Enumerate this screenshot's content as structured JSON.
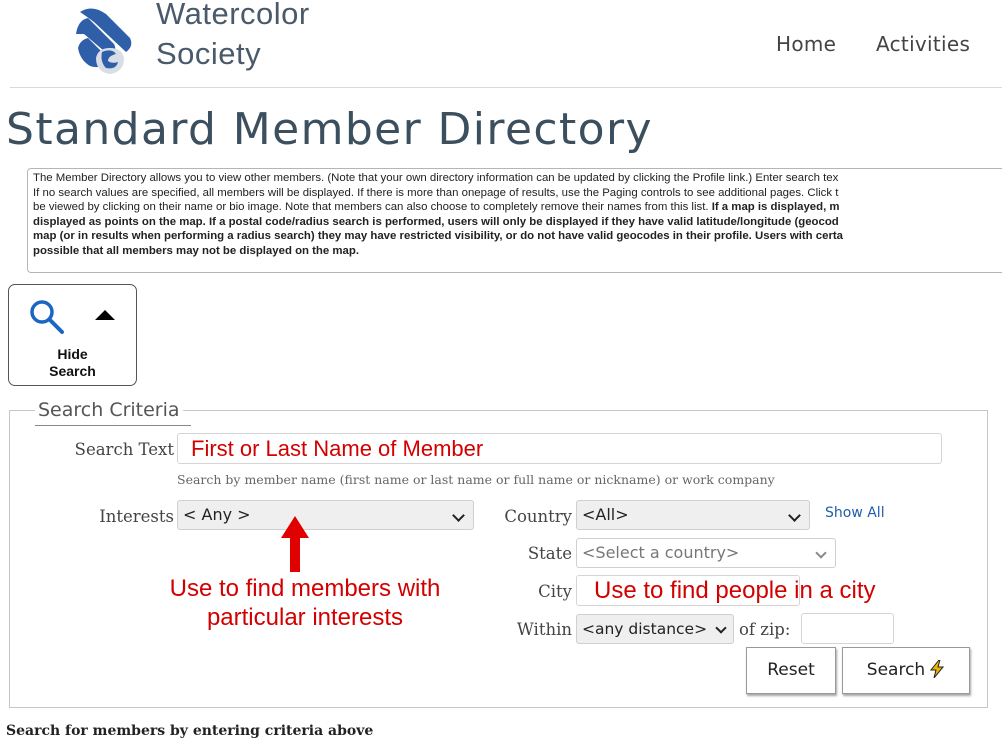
{
  "header": {
    "logo_line1": "Watercolor",
    "logo_line2": "Society",
    "nav": [
      "Home",
      "Activities"
    ]
  },
  "page_title": "Standard Member Directory",
  "info": {
    "lines": [
      "The Member Directory allows you to view other members. (Note that your own directory information can be updated by clicking the Profile link.) Enter search tex",
      "If no search values are specified, all members will be displayed. If there is more than onepage of results, use the Paging controls to see additional pages. Click t",
      "be viewed by clicking on their name or bio image. Note that members can also choose to completely remove their names from this list. If a map is displayed, m",
      "displayed as points on the map. If a postal code/radius search is performed, users will only be displayed if they have valid latitude/longitude (geocod",
      "map (or in results when performing a radius search) they may have restricted visibility, or do not have valid geocodes in their profile. Users with certa",
      "possible that all members may not be displayed on the map."
    ],
    "line3_plain": "be viewed by clicking on their name or bio image. Note that members can also choose to completely remove their names from this list. ",
    "line3_bold": "If a map is displayed, m"
  },
  "hide_search": {
    "label_line1": "Hide",
    "label_line2": "Search"
  },
  "criteria": {
    "legend": "Search Criteria",
    "search_text_label": "Search Text",
    "search_text_value": "First or Last Name of Member",
    "search_hint": "Search by member name (first name or last name or full name or nickname) or work company",
    "interests_label": "Interests",
    "interests_value": "< Any >",
    "country_label": "Country",
    "country_value": "<All>",
    "show_all": "Show All",
    "state_label": "State",
    "state_value": "<Select a country>",
    "city_label": "City",
    "city_annotation": "Use to find people in a city",
    "within_label": "Within",
    "within_value": "<any distance>",
    "of_zip_label": "of zip:",
    "zip_value": "",
    "reset_label": "Reset",
    "search_label": "Search"
  },
  "annotations": {
    "interests_line1": "Use to find members with",
    "interests_line2": "particular interests"
  },
  "status": "Search for members by entering criteria above",
  "colors": {
    "annotation_red": "#d30000",
    "title": "#3b4f5f",
    "link": "#1f5ea8",
    "logo_blue": "#2f5fa8"
  },
  "icons": [
    "logo-mark",
    "search-icon",
    "caret-up-icon",
    "chevron-down-icon",
    "lightning-icon",
    "arrow-up-icon"
  ]
}
